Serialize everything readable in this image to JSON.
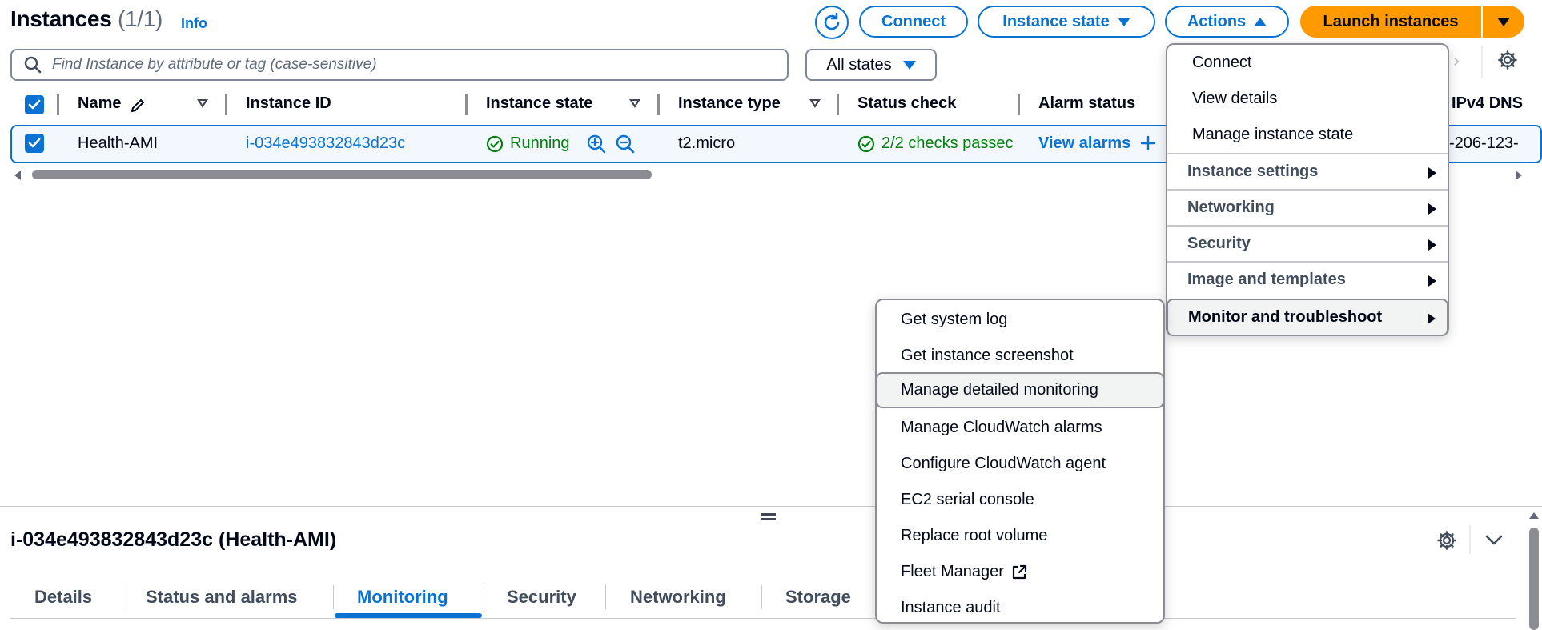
{
  "header": {
    "title": "Instances",
    "count": "(1/1)",
    "info": "Info",
    "connect_label": "Connect",
    "instance_state_label": "Instance state",
    "actions_label": "Actions",
    "launch_label": "Launch instances"
  },
  "search": {
    "placeholder": "Find Instance by attribute or tag (case-sensitive)",
    "filter_label": "All states"
  },
  "table": {
    "columns": [
      "Name",
      "Instance ID",
      "Instance state",
      "Instance type",
      "Status check",
      "Alarm status",
      "IPv4 DNS"
    ],
    "rows": [
      {
        "name": "Health-AMI",
        "instance_id": "i-034e493832843d23c",
        "state": "Running",
        "type": "t2.micro",
        "status_check": "2/2 checks passec",
        "alarm": "View alarms",
        "ipv4": "-206-123-"
      }
    ]
  },
  "actions_menu": {
    "items": [
      "Connect",
      "View details",
      "Manage instance state"
    ],
    "groups": [
      "Instance settings",
      "Networking",
      "Security",
      "Image and templates",
      "Monitor and troubleshoot"
    ]
  },
  "monitor_submenu": {
    "items": [
      "Get system log",
      "Get instance screenshot",
      "Manage detailed monitoring",
      "Manage CloudWatch alarms",
      "Configure CloudWatch agent",
      "EC2 serial console",
      "Replace root volume",
      "Fleet Manager",
      "Instance audit"
    ]
  },
  "details_panel": {
    "title": "i-034e493832843d23c (Health-AMI)",
    "tabs": [
      "Details",
      "Status and alarms",
      "Monitoring",
      "Security",
      "Networking",
      "Storage"
    ],
    "active_tab": "Monitoring"
  },
  "colors": {
    "accent": "#0972d3",
    "launch": "#ff9900",
    "success": "#037f0c"
  }
}
